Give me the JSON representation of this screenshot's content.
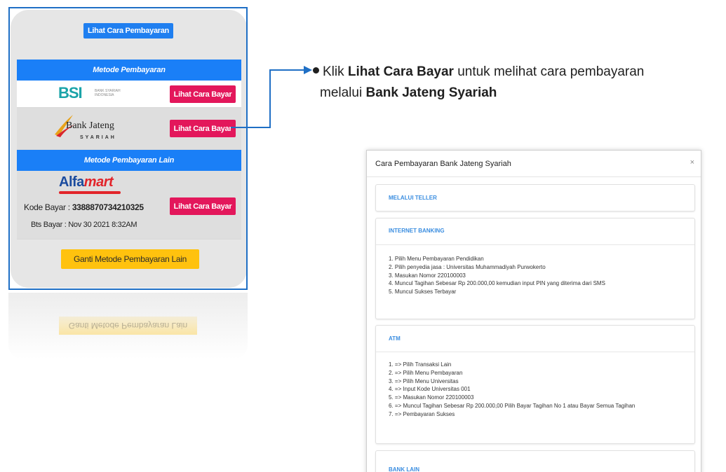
{
  "panel": {
    "top_button": "Lihat Cara Pembayaran",
    "section1": "Metode Pembayaran",
    "bsi": {
      "logo": "BSI",
      "logo_sub": "BANK SYARIAH INDONESIA",
      "button": "Lihat Cara Bayar"
    },
    "jateng": {
      "logo": "Bank Jateng",
      "logo_sub": "SYARIAH",
      "button": "Lihat Cara Bayar"
    },
    "section2": "Metode Pembayaran Lain",
    "alfamart": {
      "logo_a": "Alfa",
      "logo_b": "mart",
      "kode_label": "Kode Bayar : ",
      "kode_value": "3388870734210325",
      "bts": "Bts Bayar : Nov 30 2021 8:32AM",
      "button": "Lihat Cara Bayar"
    },
    "ganti_button": "Ganti Metode Pembayaran Lain"
  },
  "instruction": {
    "part1": "Klik ",
    "bold1": "Lihat Cara Bayar",
    "part2": " untuk melihat cara pembayaran",
    "part3": "melalui ",
    "bold2": "Bank Jateng Syariah"
  },
  "modal": {
    "title": "Cara Pembayaran Bank Jateng Syariah",
    "close": "×",
    "teller": "MELALUI TELLER",
    "internet_banking": {
      "title": "INTERNET BANKING",
      "steps": [
        "1. Pilih Menu Pembayaran Pendidikan",
        "2. Pilih penyedia jasa : Universitas Muhammadiyah Purwokerto",
        "3. Masukan Nomor 220100003",
        "4. Muncul Tagihan Sebesar Rp 200.000,00 kemudian input PIN yang diterima dari SMS",
        "5. Muncul Sukses Terbayar"
      ]
    },
    "atm": {
      "title": "ATM",
      "steps": [
        "1. => Pilih Transaksi Lain",
        "2. => Pilih Menu Pembayaran",
        "3. => Pilih Menu Universitas",
        "4. => Input Kode Universitas 001",
        "5. => Masukan Nomor 220100003",
        "6. => Muncul Tagihan Sebesar Rp 200.000,00 Pilih Bayar Tagihan No 1 atau Bayar Semua Tagihan",
        "7. => Pembayaran Sukses"
      ]
    },
    "bank_lain": "BANK LAIN"
  }
}
